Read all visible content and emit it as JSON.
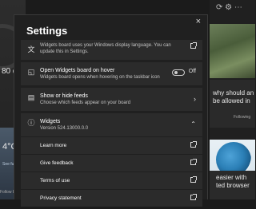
{
  "background": {
    "left_text": "80 d",
    "left_snippet_1": "4°C",
    "left_snippet_2": "See full",
    "left_snippet_3": "Follow Egyptian",
    "right_headline": "why should an\nbe allowed in",
    "right_following": "Following",
    "right_bottom": "easier with\nted browser"
  },
  "dialog": {
    "title": "Settings",
    "close_label": "×",
    "items": {
      "language_desc": "Widgets board uses your Windows display language. You can update this in Settings.",
      "hover_title": "Open Widgets board on hover",
      "hover_desc": "Widgets board opens when hovering on the taskbar icon",
      "hover_toggle_label": "Off",
      "feeds_title": "Show or hide feeds",
      "feeds_desc": "Choose which feeds appear on your board",
      "widgets_title": "Widgets",
      "widgets_version": "Version 524.13000.0.0",
      "learn_more": "Learn more",
      "give_feedback": "Give feedback",
      "terms_of_use": "Terms of use",
      "privacy_statement": "Privacy statement"
    }
  }
}
